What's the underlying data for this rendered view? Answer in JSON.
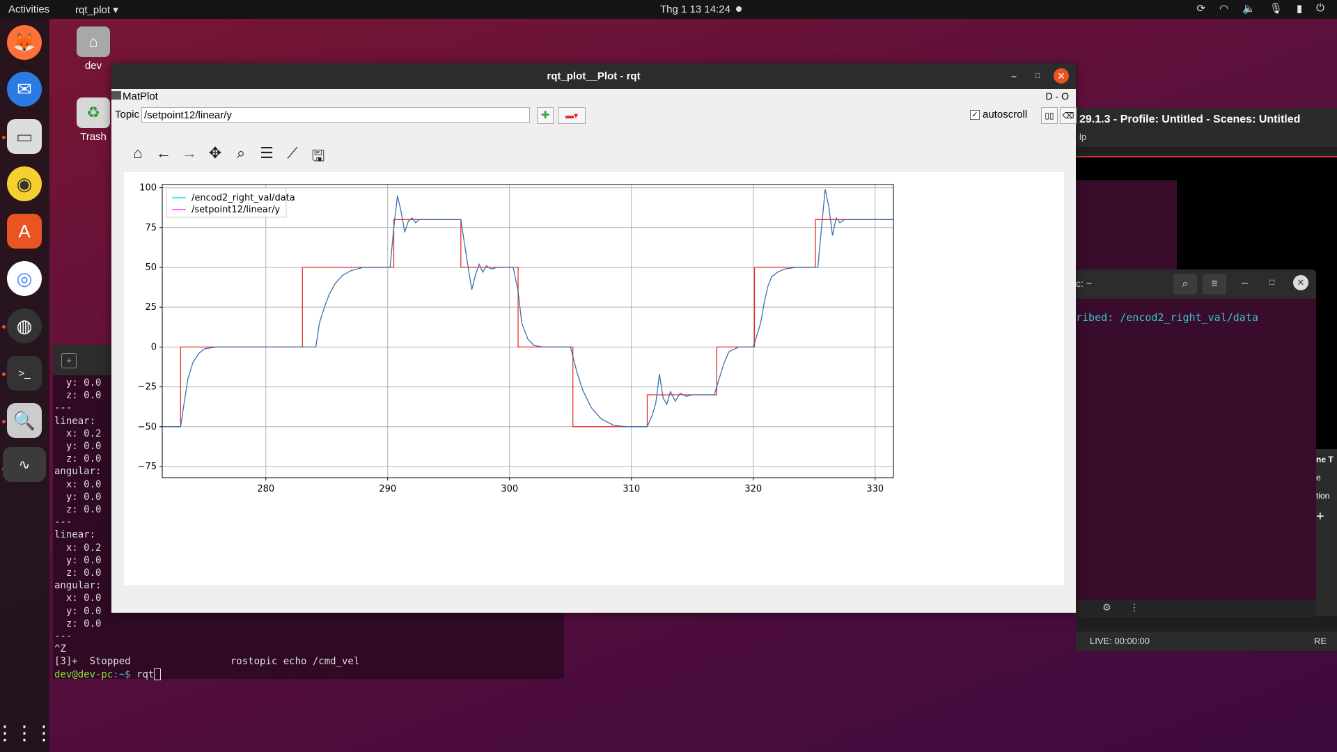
{
  "topbar": {
    "activities": "Activities",
    "app": "rqt_plot ▾",
    "clock": "Thg 1 13  14:24"
  },
  "desktop": {
    "home_label": "dev",
    "trash_label": "Trash"
  },
  "obs": {
    "title": "29.1.3 - Profile: Untitled - Scenes: Untitled",
    "menu": "lp",
    "status": "LIVE: 00:00:00",
    "status2": "RE",
    "side1": "ne T",
    "side2": "e",
    "side3": "tion"
  },
  "term2": {
    "title": "c: ~",
    "text": "ribed: /encod2_right_val/data"
  },
  "term1": {
    "lines": [
      "  y: 0.0",
      "  z: 0.0",
      "---",
      "linear:",
      "  x: 0.2",
      "  y: 0.0",
      "  z: 0.0",
      "angular:",
      "  x: 0.0",
      "  y: 0.0",
      "  z: 0.0",
      "---",
      "linear:",
      "  x: 0.2",
      "  y: 0.0",
      "  z: 0.0",
      "angular:",
      "  x: 0.0",
      "  y: 0.0",
      "  z: 0.0",
      "---",
      "^Z",
      "[3]+  Stopped                 rostopic echo /cmd_vel"
    ],
    "prompt_user": "dev@dev-pc",
    "prompt_path": ":~$ ",
    "prompt_cmd": "rqt"
  },
  "rqt": {
    "title": "rqt_plot__Plot - rqt",
    "plugin": "MatPlot",
    "topic_label": "Topic",
    "topic_value": "/setpoint12/linear/y",
    "autoscroll": "autoscroll",
    "head_right": "D  - O"
  },
  "chart_data": {
    "type": "line",
    "title": "",
    "xlabel": "",
    "ylabel": "",
    "xlim": [
      271.5,
      331.5
    ],
    "ylim": [
      -82,
      102
    ],
    "xticks": [
      280,
      290,
      300,
      310,
      320,
      330
    ],
    "yticks": [
      100,
      75,
      50,
      25,
      0,
      -25,
      -50,
      -75
    ],
    "grid": true,
    "legend": "top-left",
    "series": [
      {
        "name": "/encod2_right_val/data",
        "legend_color": "#00e5ff",
        "color": "#3a6fb0",
        "x": [
          271.5,
          273.0,
          273.3,
          273.6,
          274.0,
          274.5,
          275.0,
          276.0,
          277.0,
          283.0,
          284.1,
          284.4,
          284.8,
          285.2,
          285.7,
          286.3,
          287.0,
          288.0,
          289.0,
          290.2,
          290.5,
          290.8,
          291.1,
          291.4,
          291.7,
          292.0,
          292.3,
          292.6,
          293.0,
          294.0,
          296.0,
          296.3,
          296.6,
          296.9,
          297.2,
          297.5,
          297.8,
          298.1,
          298.5,
          299.0,
          300.3,
          300.7,
          301.0,
          301.5,
          302.0,
          302.7,
          303.5,
          305.0,
          305.5,
          306.0,
          306.7,
          307.5,
          308.5,
          309.5,
          311.3,
          311.7,
          312.0,
          312.3,
          312.6,
          312.9,
          313.2,
          313.6,
          314.0,
          314.5,
          315.0,
          316.8,
          317.2,
          317.6,
          318.0,
          318.8,
          320.0,
          320.6,
          320.9,
          321.2,
          321.5,
          322.0,
          322.6,
          323.5,
          324.5,
          325.3,
          325.6,
          325.9,
          326.2,
          326.5,
          326.8,
          327.1,
          327.5,
          328.0,
          329.0,
          331.5
        ],
        "y": [
          -50,
          -50,
          -35,
          -20,
          -10,
          -4,
          -1,
          0,
          0,
          0,
          0,
          15,
          25,
          33,
          40,
          45,
          48,
          50,
          50,
          50,
          75,
          95,
          85,
          72,
          79,
          81,
          78,
          80,
          80,
          80,
          80,
          65,
          50,
          36,
          45,
          52,
          47,
          51,
          49,
          50,
          50,
          35,
          15,
          5,
          1,
          0,
          0,
          0,
          -15,
          -27,
          -38,
          -45,
          -49,
          -50,
          -50,
          -43,
          -35,
          -17,
          -32,
          -36,
          -28,
          -34,
          -29,
          -31,
          -30,
          -30,
          -20,
          -10,
          -3,
          0,
          0,
          15,
          28,
          38,
          44,
          47,
          49,
          50,
          50,
          50,
          75,
          99,
          88,
          70,
          81,
          78,
          80,
          80,
          80,
          80
        ]
      },
      {
        "name": "/setpoint12/linear/y",
        "legend_color": "#ff33ff",
        "color": "#e8302a",
        "x": [
          271.5,
          273.0,
          273.0,
          283.0,
          283.0,
          290.5,
          290.5,
          296.0,
          296.0,
          300.7,
          300.7,
          305.2,
          305.2,
          311.3,
          311.3,
          317.0,
          317.0,
          320.1,
          320.1,
          325.1,
          325.1,
          331.5
        ],
        "y": [
          -50,
          -50,
          0,
          0,
          50,
          50,
          80,
          80,
          50,
          50,
          0,
          0,
          -50,
          -50,
          -30,
          -30,
          0,
          0,
          50,
          50,
          80,
          80
        ]
      }
    ]
  }
}
